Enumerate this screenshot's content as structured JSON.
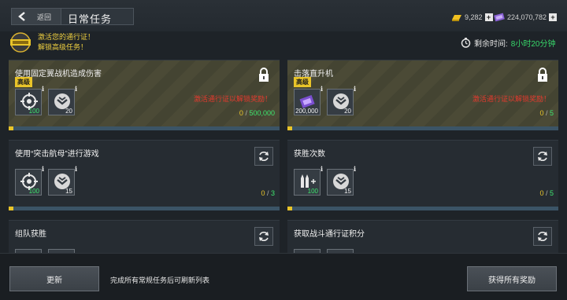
{
  "header": {
    "back_label": "返回",
    "title": "日常任务"
  },
  "currencies": [
    {
      "name": "gold",
      "value": "9,282",
      "icon": "gold-bar-icon",
      "color": "#f0c020"
    },
    {
      "name": "credits",
      "value": "224,070,782",
      "icon": "ticket-icon",
      "color": "#9c7ae0"
    }
  ],
  "pass": {
    "line1": "激活您的通行证！",
    "line2": "解锁高级任务！"
  },
  "timer": {
    "label": "剩余时间:",
    "value": "8小时20分钟"
  },
  "tasks": [
    {
      "name": "使用固定翼战机造成伤害",
      "tag": "高级",
      "premium": true,
      "unlock_msg": "激活通行证以解锁奖励！",
      "rewards": [
        {
          "icon": "crosshair-icon",
          "count": "100",
          "green": true
        },
        {
          "icon": "emblem-icon",
          "count": "20",
          "green": false
        }
      ],
      "progress": {
        "current": "0",
        "total": "500,000",
        "fraction": 0
      }
    },
    {
      "name": "击落直升机",
      "tag": "高级",
      "premium": true,
      "unlock_msg": "激活通行证以解锁奖励！",
      "rewards": [
        {
          "icon": "purple-ticket-icon",
          "count": "200,000",
          "green": false
        },
        {
          "icon": "emblem-icon",
          "count": "20",
          "green": false
        }
      ],
      "progress": {
        "current": "0",
        "total": "5",
        "fraction": 0
      }
    },
    {
      "name": "使用“突击航母”进行游戏",
      "premium": false,
      "rewards": [
        {
          "icon": "crosshair-icon",
          "count": "100",
          "green": true
        },
        {
          "icon": "emblem-icon",
          "count": "15",
          "green": false
        }
      ],
      "progress": {
        "current": "0",
        "total": "3",
        "fraction": 0
      }
    },
    {
      "name": "获胜次数",
      "premium": false,
      "rewards": [
        {
          "icon": "ammo-icon",
          "count": "100",
          "green": true
        },
        {
          "icon": "emblem-icon",
          "count": "15",
          "green": false
        }
      ],
      "progress": {
        "current": "0",
        "total": "5",
        "fraction": 0
      }
    },
    {
      "name": "组队获胜",
      "premium": false
    },
    {
      "name": "获取战斗通行证积分",
      "premium": false
    }
  ],
  "footer": {
    "refresh_label": "更新",
    "hint": "完成所有常规任务后可刷新列表",
    "claim_label": "获得所有奖励"
  }
}
